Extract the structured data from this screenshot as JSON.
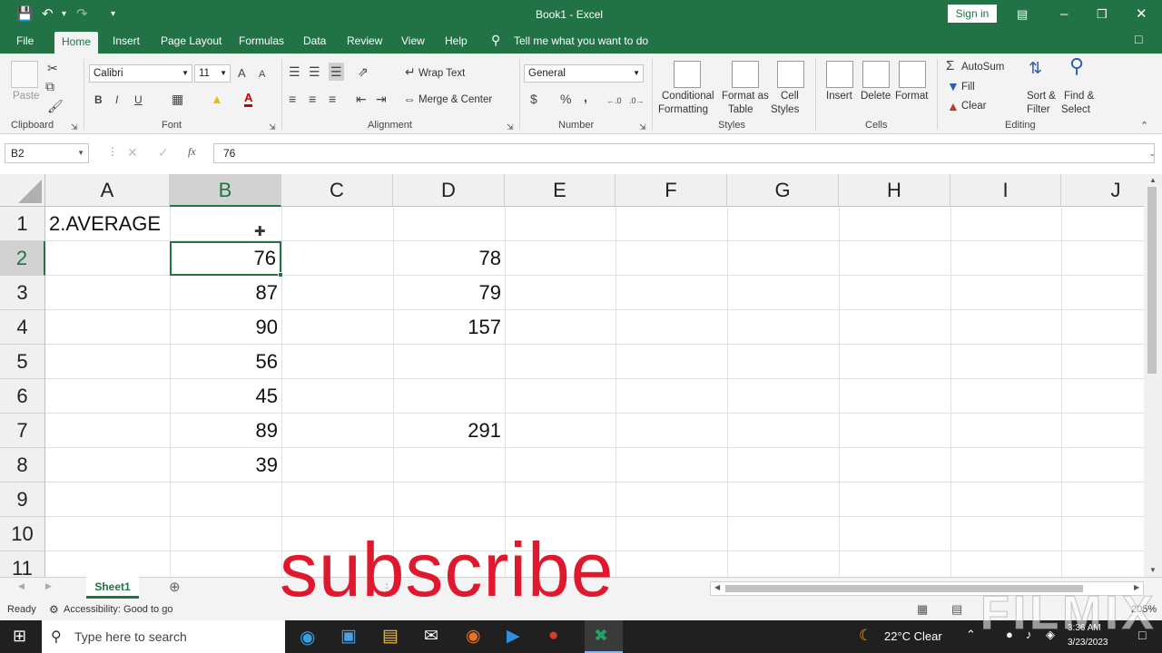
{
  "window": {
    "title": "Book1  -  Excel",
    "sign_in": "Sign in"
  },
  "tabs": [
    {
      "label": "File"
    },
    {
      "label": "Home"
    },
    {
      "label": "Insert"
    },
    {
      "label": "Page Layout"
    },
    {
      "label": "Formulas"
    },
    {
      "label": "Data"
    },
    {
      "label": "Review"
    },
    {
      "label": "View"
    },
    {
      "label": "Help"
    }
  ],
  "tell_me": "Tell me what you want to do",
  "ribbon": {
    "clipboard": {
      "paste": "Paste",
      "group": "Clipboard"
    },
    "font": {
      "name": "Calibri",
      "size": "11",
      "group": "Font",
      "bold": "B",
      "italic": "I",
      "underline": "U",
      "grow": "A",
      "shrink": "A",
      "color": "A"
    },
    "alignment": {
      "wrap": "Wrap Text",
      "merge": "Merge & Center",
      "group": "Alignment"
    },
    "number": {
      "format": "General",
      "currency": "$",
      "percent": "%",
      "comma": ",",
      "group": "Number"
    },
    "styles": {
      "cond1": "Conditional",
      "cond2": "Formatting",
      "fmt1": "Format as",
      "fmt2": "Table",
      "cell1": "Cell",
      "cell2": "Styles",
      "group": "Styles"
    },
    "cells": {
      "insert": "Insert",
      "delete": "Delete",
      "format": "Format",
      "group": "Cells"
    },
    "editing": {
      "autosum": "AutoSum",
      "fill": "Fill",
      "clear": "Clear",
      "sort1": "Sort &",
      "sort2": "Filter",
      "find1": "Find &",
      "find2": "Select",
      "group": "Editing"
    }
  },
  "formula_bar": {
    "name_box": "B2",
    "fx": "fx",
    "value": "76"
  },
  "columns": [
    "A",
    "B",
    "C",
    "D",
    "E",
    "F",
    "G",
    "H",
    "I",
    "J"
  ],
  "rows": [
    "1",
    "2",
    "3",
    "4",
    "5",
    "6",
    "7",
    "8",
    "9",
    "10",
    "11"
  ],
  "cells": {
    "A1": "2.AVERAGE",
    "B2": "76",
    "B3": "87",
    "B4": "90",
    "B5": "56",
    "B6": "45",
    "B7": "89",
    "B8": "39",
    "D2": "78",
    "D3": "79",
    "D4": "157",
    "D7": "291"
  },
  "selected": {
    "column": "B",
    "row": "2"
  },
  "sheet_tab": "Sheet1",
  "status": {
    "ready": "Ready",
    "accessibility": "Accessibility: Good to go",
    "zoom": "205%"
  },
  "overlay": {
    "subscribe": "subscribe",
    "watermark": "FILMIX"
  },
  "taskbar": {
    "search": "Type here to search",
    "weather": "22°C  Clear",
    "time": "3:36 AM",
    "date": "3/23/2023"
  },
  "colors": {
    "accent": "#217346",
    "overlay_red": "#e0182d"
  }
}
